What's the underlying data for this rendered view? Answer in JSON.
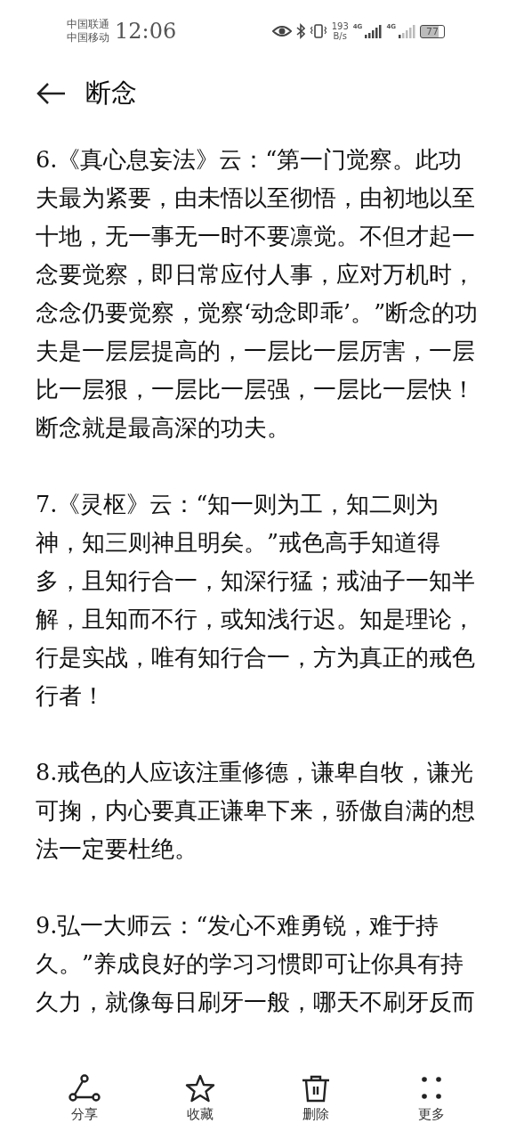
{
  "status_bar": {
    "carriers": [
      "中国联通",
      "中国移动"
    ],
    "time": "12:06",
    "speed_value": "193",
    "speed_unit": "B/s",
    "network_1": "4G",
    "network_2": "4G",
    "battery": "77"
  },
  "header": {
    "title": "断念"
  },
  "paragraphs": [
    "6.《真心息妄法》云：“第一门觉察。此功夫最为紧要，由未悟以至彻悟，由初地以至十地，无一事无一时不要凛觉。不但才起一念要觉察，即日常应付人事，应对万机时，念念仍要觉察，觉察‘动念即乖’。”断念的功夫是一层层提高的，一层比一层厉害，一层比一层狠，一层比一层强，一层比一层快！断念就是最高深的功夫。",
    "7.《灵枢》云：“知一则为工，知二则为神，知三则神且明矣。”戒色高手知道得多，且知行合一，知深行猛；戒油子一知半解，且知而不行，或知浅行迟。知是理论，行是实战，唯有知行合一，方为真正的戒色行者！",
    "8.戒色的人应该注重修德，谦卑自牧，谦光可掬，内心要真正谦卑下来，骄傲自满的想法一定要杜绝。",
    "9.弘一大师云：“发心不难勇锐，难于持久。”养成良好的学习习惯即可让你具有持久力，就像每日刷牙一般，哪天不刷牙反而"
  ],
  "toolbar": [
    {
      "kind": "share",
      "label": "分享"
    },
    {
      "kind": "favorite",
      "label": "收藏"
    },
    {
      "kind": "delete",
      "label": "删除"
    },
    {
      "kind": "more",
      "label": "更多"
    }
  ]
}
